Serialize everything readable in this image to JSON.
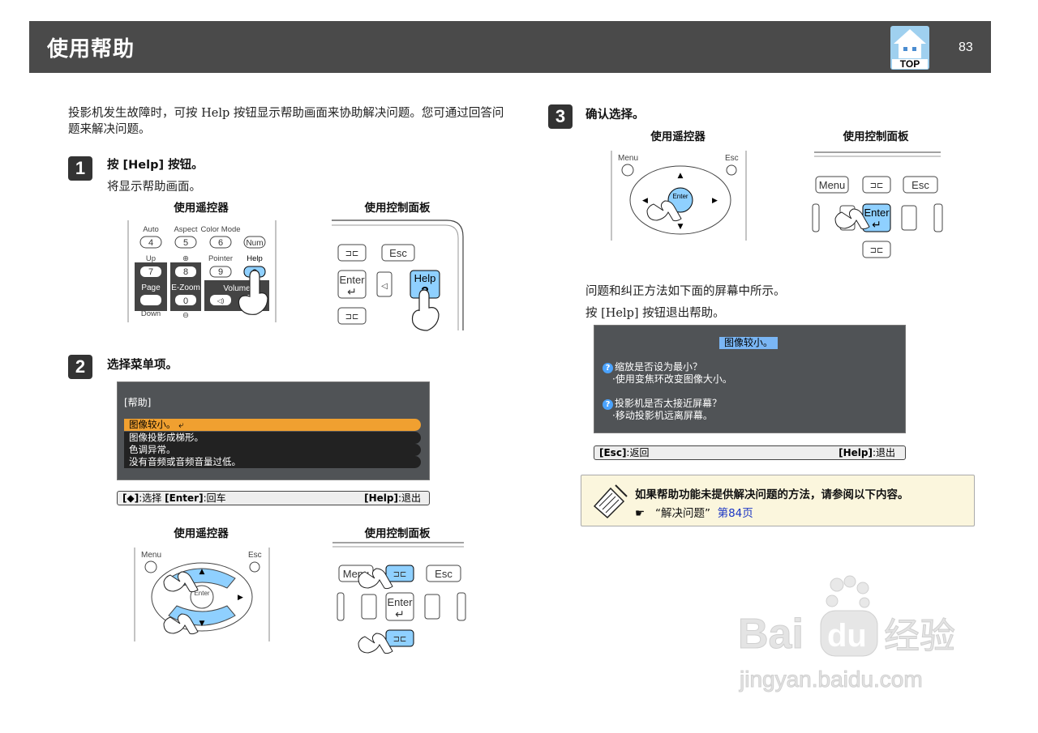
{
  "header": {
    "title": "使用帮助",
    "top_label": "TOP",
    "page_number": "83"
  },
  "intro": "投影机发生故障时，可按 Help 按钮显示帮助画面来协助解决问题。您可通过回答问题来解决问题。",
  "step1": {
    "number": "1",
    "title": "按 [Help] 按钮。",
    "text": "将显示帮助画面。",
    "remote_caption": "使用遥控器",
    "panel_caption": "使用控制面板",
    "remote": {
      "row1": [
        "Auto",
        "Aspect",
        "Color Mode",
        "Help"
      ],
      "keys1": [
        "4",
        "5",
        "6",
        "Num"
      ],
      "row2": [
        "Up",
        "Pointer",
        "Help"
      ],
      "keys2": [
        "7",
        "8",
        "9",
        "?"
      ],
      "labels3": [
        "Page",
        "E-Zoom",
        "Volume"
      ],
      "key0": "0",
      "down": "Down"
    },
    "panel": {
      "esc": "Esc",
      "enter": "Enter",
      "help": "Help",
      "help_q": "?"
    }
  },
  "step2": {
    "number": "2",
    "title": "选择菜单项。",
    "menu_header": "[帮助]",
    "menu_items": [
      "图像较小。",
      "图像投影成梯形。",
      "色调异常。",
      "没有音频或音频音量过低。"
    ],
    "status_left": "[◆]:选择 [Enter]:回车",
    "status_left_a": "[◆]",
    "status_left_b": ":选择",
    "status_left_c": "[Enter]",
    "status_left_d": ":回车",
    "status_right_a": "[Help]",
    "status_right_b": ":退出",
    "remote_caption": "使用遥控器",
    "panel_caption": "使用控制面板",
    "remote": {
      "menu": "Menu",
      "esc": "Esc",
      "enter": "Enter"
    },
    "panel": {
      "menu": "Menu",
      "esc": "Esc",
      "enter": "Enter"
    }
  },
  "step3": {
    "number": "3",
    "title": "确认选择。",
    "remote_caption": "使用遥控器",
    "panel_caption": "使用控制面板",
    "remote": {
      "menu": "Menu",
      "esc": "Esc",
      "enter": "Enter"
    },
    "panel": {
      "menu": "Menu",
      "esc": "Esc",
      "enter": "Enter"
    },
    "text1": "问题和纠正方法如下面的屏幕中所示。",
    "text2": "按 [Help] 按钮退出帮助。",
    "help_screen": {
      "title": "图像较小。",
      "q1": "缩放是否设为最小？",
      "a1": "·使用变焦环改变图像大小。",
      "q2": "投影机是否太接近屏幕？",
      "a2": "·移动投影机远离屏幕。"
    },
    "status_left_a": "[Esc]",
    "status_left_b": ":返回",
    "status_right_a": "[Help]",
    "status_right_b": ":退出"
  },
  "note": {
    "text": "如果帮助功能未提供解决问题的方法，请参阅以下内容。",
    "ref_pointer": "☛",
    "ref_text": "“解决问题”",
    "ref_link": "第84页"
  },
  "watermark": {
    "brand": "Bai du 经验",
    "url": "jingyan.baidu.com"
  }
}
